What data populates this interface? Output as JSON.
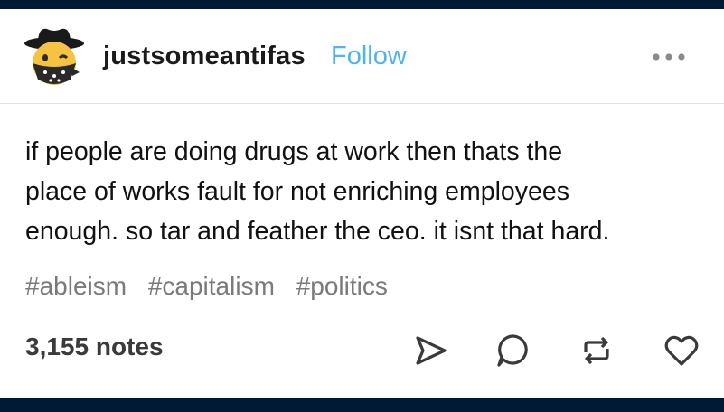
{
  "post": {
    "username": "justsomeantifas",
    "follow_label": "Follow",
    "body_lines": [
      "if people are doing drugs at work then thats the",
      "place of works fault for not enriching employees",
      "enough. so tar and feather the ceo. it isnt that hard."
    ],
    "tags": [
      "#ableism",
      "#capitalism",
      "#politics"
    ],
    "notes": "3,155 notes"
  },
  "icons": {
    "avatar": "cowboy-bandana-avatar",
    "more": "more-dots-icon",
    "share": "share-paper-plane-icon",
    "reply": "reply-speech-bubble-icon",
    "reblog": "reblog-icon",
    "like": "heart-icon"
  },
  "colors": {
    "background": "#001935",
    "follow": "#4fb4ec",
    "tags": "#7a7a7a"
  }
}
